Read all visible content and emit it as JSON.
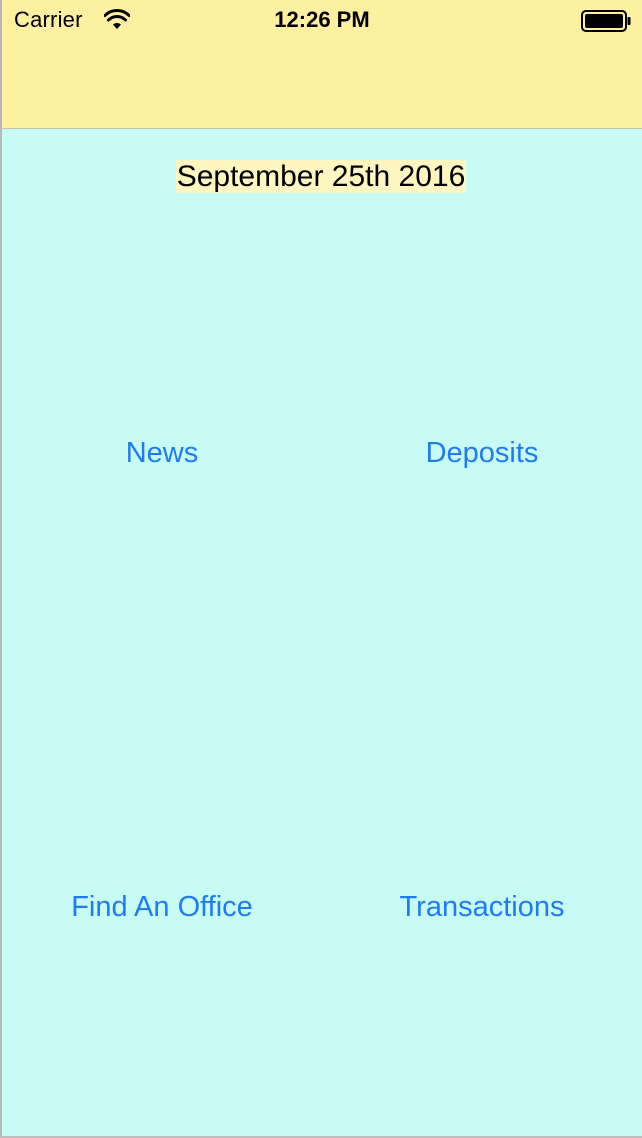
{
  "status_bar": {
    "carrier": "Carrier",
    "time": "12:26 PM",
    "wifi_icon": "wifi-icon",
    "battery_icon": "battery-icon"
  },
  "header": {
    "background_color": "#fef0a1"
  },
  "main": {
    "background_color": "#c9fbf6",
    "date_label": "September 25th 2016",
    "buttons": [
      {
        "label": "News"
      },
      {
        "label": "Deposits"
      },
      {
        "label": "Find An Office"
      },
      {
        "label": "Transactions"
      }
    ],
    "button_color": "#1f7bf2"
  }
}
